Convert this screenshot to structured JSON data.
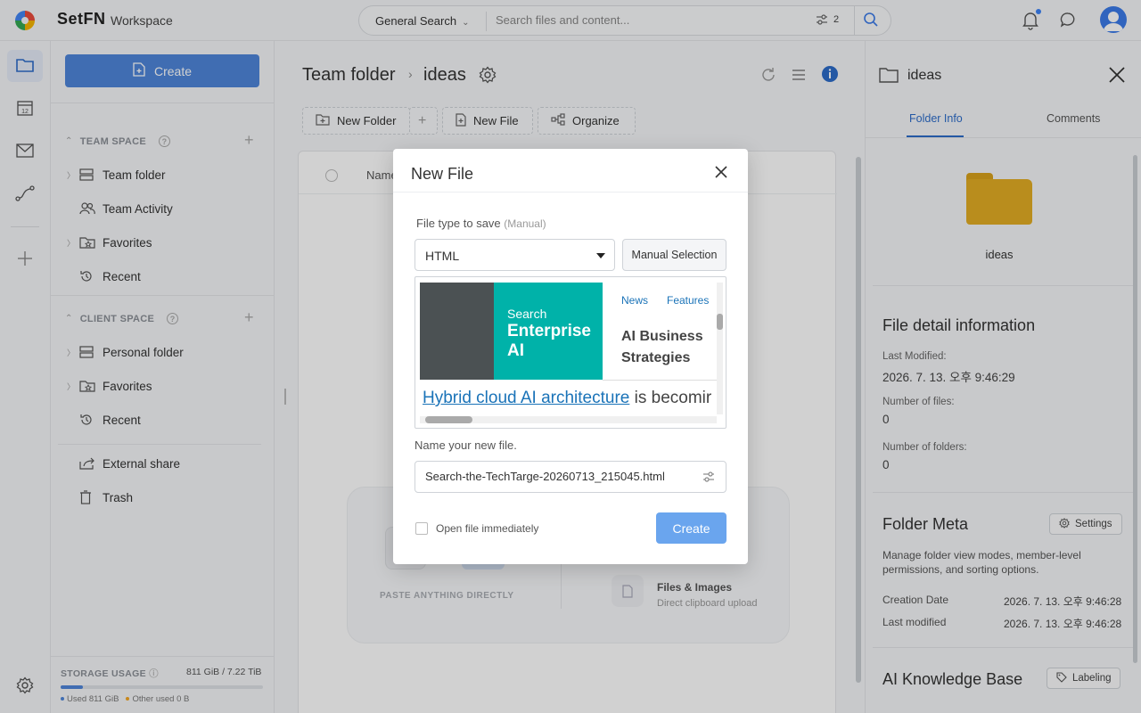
{
  "app": {
    "brand": "SetFN",
    "workspace": "Workspace"
  },
  "search": {
    "scope": "General Search",
    "placeholder": "Search files and content...",
    "filter_count": "2"
  },
  "sidebar": {
    "create_label": "Create",
    "team_space": {
      "header": "TEAM SPACE",
      "items": [
        {
          "label": "Team folder"
        },
        {
          "label": "Team Activity"
        },
        {
          "label": "Favorites"
        },
        {
          "label": "Recent"
        }
      ]
    },
    "client_space": {
      "header": "CLIENT SPACE",
      "items": [
        {
          "label": "Personal folder"
        },
        {
          "label": "Favorites"
        },
        {
          "label": "Recent"
        }
      ]
    },
    "extra_items": [
      {
        "label": "External share"
      },
      {
        "label": "Trash"
      }
    ],
    "storage": {
      "label": "STORAGE USAGE",
      "total": "811 GiB / 7.22 TiB",
      "used": "Used 811 GiB",
      "other": "Other used 0 B",
      "used_fraction": 0.11
    }
  },
  "main": {
    "breadcrumb": [
      "Team folder",
      "ideas"
    ],
    "toolbar": {
      "new_folder": "New Folder",
      "new_file": "New File",
      "organize": "Organize"
    },
    "table": {
      "name_header": "Name"
    },
    "paste": {
      "title": "PASTE ANYTHING DIRECTLY",
      "files_title": "Files & Images",
      "files_sub": "Direct clipboard upload"
    }
  },
  "right_panel": {
    "title": "ideas",
    "tabs": [
      "Folder Info",
      "Comments"
    ],
    "folder_name": "ideas",
    "detail": {
      "heading": "File detail information",
      "last_modified_label": "Last Modified:",
      "last_modified_value": "2026. 7. 13. 오후 9:46:29",
      "num_files_label": "Number of files:",
      "num_files_value": "0",
      "num_folders_label": "Number of folders:",
      "num_folders_value": "0"
    },
    "meta": {
      "heading": "Folder Meta",
      "settings_label": "Settings",
      "description": "Manage folder view modes, member-level permissions, and sorting options.",
      "creation_date_label": "Creation Date",
      "creation_date_value": "2026. 7. 13. 오후 9:46:28",
      "last_modified_label": "Last modified",
      "last_modified_value": "2026. 7. 13. 오후 9:46:28"
    },
    "kb": {
      "heading": "AI Knowledge Base",
      "labeling_label": "Labeling"
    }
  },
  "modal": {
    "title": "New File",
    "file_type_label": "File type to save",
    "file_type_hint": "(Manual)",
    "file_type_value": "HTML",
    "manual_button": "Manual Selection",
    "preview": {
      "brand_line1": "Search",
      "brand_line2": "Enterprise AI",
      "nav": [
        "News",
        "Features"
      ],
      "headline": "AI Business Strategies",
      "article_link": "Hybrid cloud AI architecture",
      "article_rest": " is becomir"
    },
    "name_label": "Name your new file.",
    "name_value": "Search-the-TechTarge-20260713_215045.html",
    "open_immediately_label": "Open file immediately",
    "create_label": "Create"
  },
  "colors": {
    "accent": "#4f86d9",
    "create_button": "#6aa5ee",
    "folder": "#e2ad24",
    "preview_teal": "#00b2a9"
  }
}
